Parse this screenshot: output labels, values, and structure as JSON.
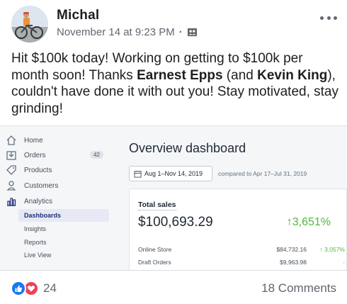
{
  "post": {
    "author": "Michal",
    "timestamp": "November 14 at 9:23 PM",
    "separator": "·",
    "audience_icon": "friends-icon",
    "more_icon": "more-options-icon",
    "text": {
      "part1": "Hit $100k today! Working on getting to $100k per month soon! Thanks ",
      "mention1": "Earnest Epps",
      "part2": " (and ",
      "mention2": "Kevin King",
      "part3": "), couldn't have done it with out you! Stay motivated, stay grinding!"
    }
  },
  "screenshot": {
    "sidebar": {
      "items": [
        {
          "label": "Home",
          "icon": "home-icon"
        },
        {
          "label": "Orders",
          "icon": "orders-icon",
          "badge": "42"
        },
        {
          "label": "Products",
          "icon": "tag-icon"
        },
        {
          "label": "Customers",
          "icon": "customers-icon"
        },
        {
          "label": "Analytics",
          "icon": "analytics-icon"
        }
      ],
      "sub_items": [
        {
          "label": "Dashboards",
          "active": true
        },
        {
          "label": "Insights"
        },
        {
          "label": "Reports"
        },
        {
          "label": "Live View"
        }
      ]
    },
    "main": {
      "title": "Overview dashboard",
      "date_range": "Aug 1–Nov 14, 2019",
      "compare_text": "compared to Apr 17–Jul 31, 2019",
      "card": {
        "title": "Total sales",
        "value": "$100,693.29",
        "change": "↑3,651%",
        "rows": [
          {
            "label": "Online Store",
            "value": "$84,732.16",
            "change": "↑ 3,057%"
          },
          {
            "label": "Draft Orders",
            "value": "$9,963.98",
            "change": "-"
          }
        ]
      }
    },
    "colors": {
      "positive": "#50b83c",
      "active_nav": "#202e78"
    }
  },
  "footer": {
    "reactions": [
      "like-icon",
      "love-icon"
    ],
    "reaction_count": "24",
    "comments": "18 Comments"
  }
}
